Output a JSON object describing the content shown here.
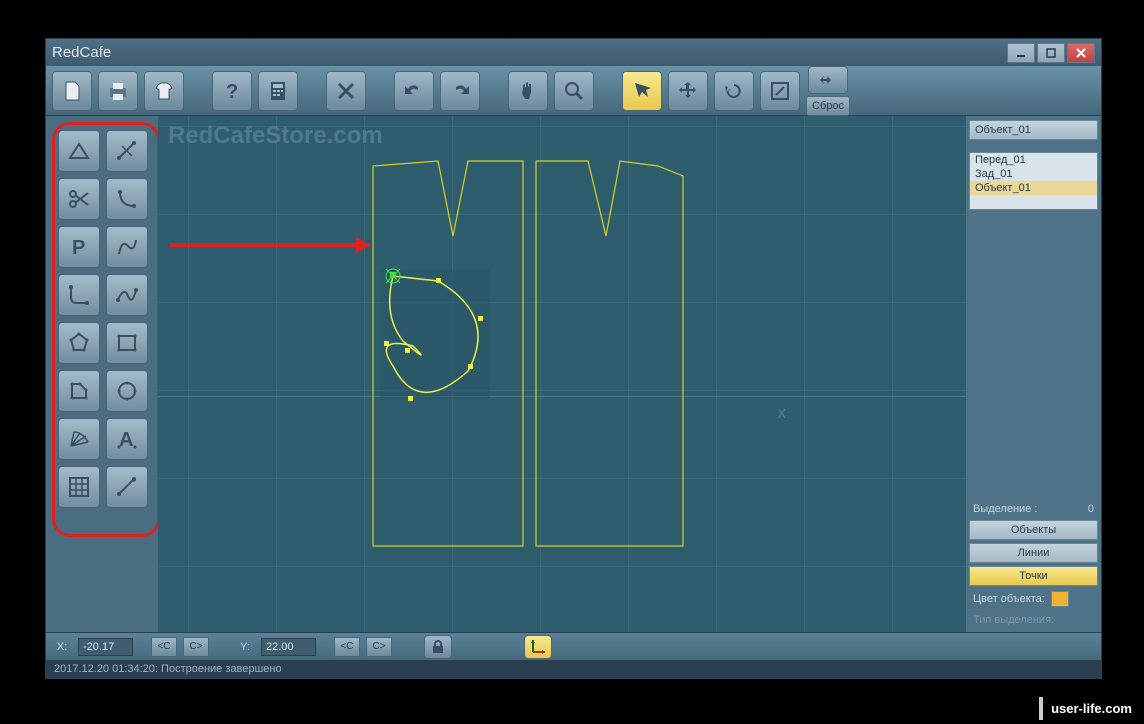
{
  "app": {
    "title": "RedCafe"
  },
  "toolbar": {
    "reset_label": "Сброс"
  },
  "watermark": "RedCafeStore.com",
  "axis": {
    "x_label": "X"
  },
  "object_header": "Объект_01",
  "object_list": [
    {
      "name": "Перед_01",
      "selected": false
    },
    {
      "name": "Зад_01",
      "selected": false
    },
    {
      "name": "Объект_01",
      "selected": true
    }
  ],
  "selection": {
    "label": "Выделение :",
    "count": "0"
  },
  "panel_buttons": {
    "objects": "Объекты",
    "lines": "Линии",
    "points": "Точки"
  },
  "color_object": {
    "label": "Цвет объекта:"
  },
  "type_selection": "Тип выделения:",
  "coords": {
    "x_label": "X:",
    "x_val": "-20.17",
    "y_label": "Y:",
    "y_val": "22.00",
    "lt": "<C",
    "gt": "C>"
  },
  "status": "2017.12.20 01:34:20: Построение завершено",
  "credit": "user-life.com"
}
